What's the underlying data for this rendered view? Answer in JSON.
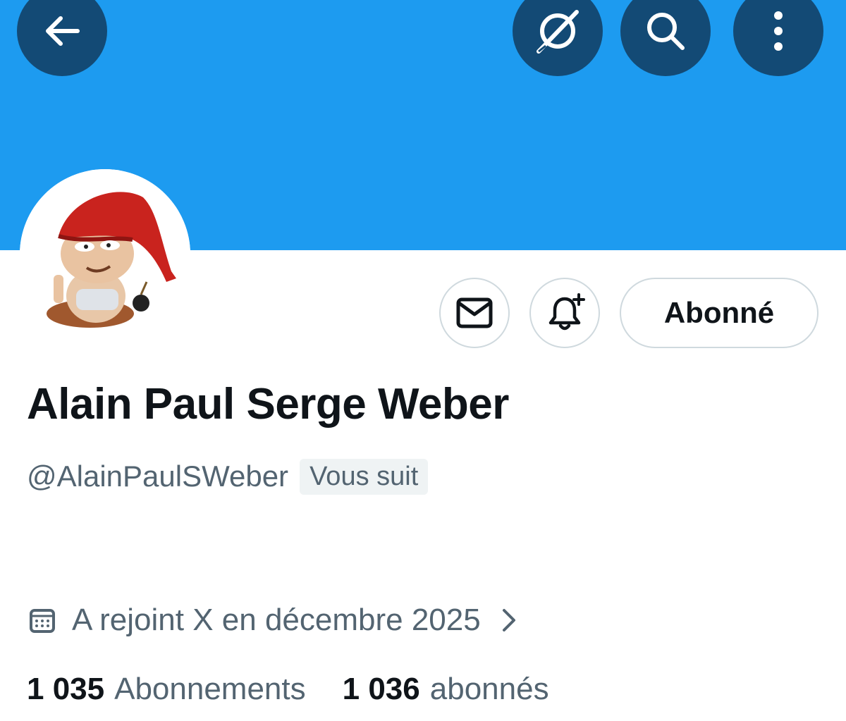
{
  "header": {
    "icons": [
      "back-arrow-icon",
      "grok-icon",
      "search-icon",
      "more-vertical-icon"
    ],
    "banner_color": "#1d9bf0",
    "button_color": "#134a75"
  },
  "profile": {
    "name": "Alain Paul Serge Weber",
    "handle": "@AlainPaulSWeber",
    "follows_you_badge": "Vous suit",
    "joined": "A rejoint X en décembre 2025",
    "following_count": "1 035",
    "following_label": "Abonnements",
    "followers_count": "1 036",
    "followers_label": "abonnés"
  },
  "actions": {
    "message_icon": "envelope-icon",
    "notify_icon": "bell-plus-icon",
    "follow_label": "Abonné"
  }
}
